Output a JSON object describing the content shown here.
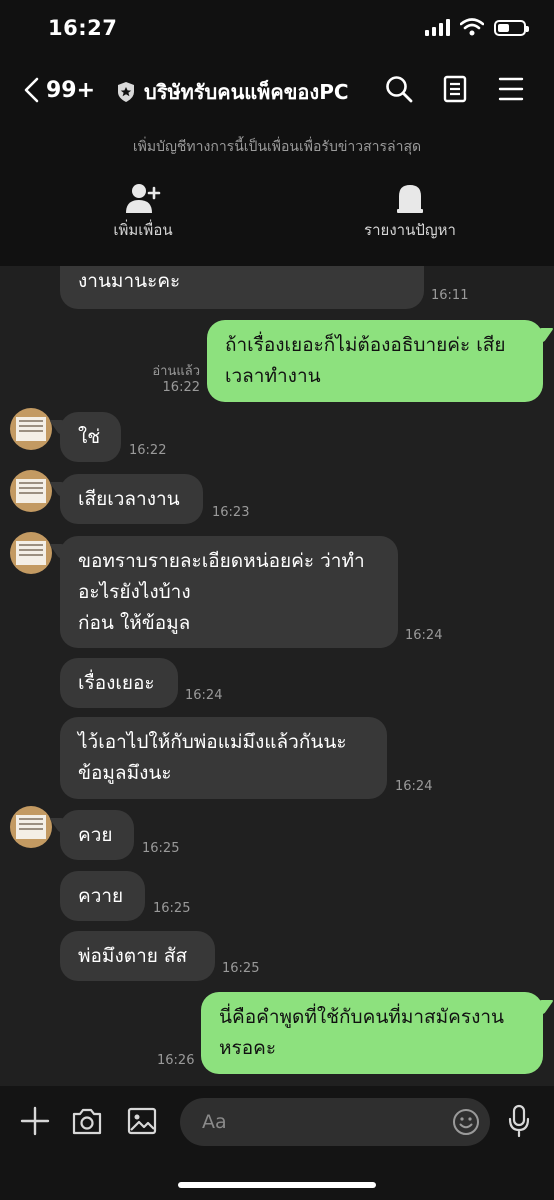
{
  "status_bar": {
    "time": "16:27",
    "battery_level": 0.45
  },
  "header": {
    "back_count": "99+",
    "title": "บริษัทรับคนแพ็คของPC",
    "subtitle": "เพิ่มบัญชีทางการนี้เป็นเพื่อนเพื่อรับข่าวสารล่าสุด",
    "actions": [
      {
        "label": "เพิ่มเพื่อน",
        "icon": "add-friend-icon"
      },
      {
        "label": "รายงานปัญหา",
        "icon": "report-icon"
      }
    ]
  },
  "messages": [
    {
      "sender": "them",
      "lines": [
        "งานมานะคะ"
      ],
      "time": "16:11"
    },
    {
      "sender": "me",
      "lines": [
        "ถ้าเรื่องเยอะก็ไม่ต้องอธิบายค่ะ เสีย",
        "เวลาทำงาน"
      ],
      "time": "16:22",
      "read_label": "อ่านแล้ว"
    },
    {
      "sender": "them",
      "lines": [
        "ใช่"
      ],
      "time": "16:22"
    },
    {
      "sender": "them",
      "lines": [
        "เสียเวลางาน"
      ],
      "time": "16:23"
    },
    {
      "sender": "them",
      "lines": [
        "ขอทราบรายละเอียดหน่อยค่ะ ว่าทำ",
        "อะไรยังไงบ้าง",
        "ก่อน ให้ข้อมูล"
      ],
      "time": "16:24"
    },
    {
      "sender": "them",
      "lines": [
        "เรื่องเยอะ"
      ],
      "time": "16:24"
    },
    {
      "sender": "them",
      "lines": [
        "ไว้เอาไปให้กับพ่อแม่มึงแล้วกันนะ",
        "ข้อมูลมึงนะ"
      ],
      "time": "16:24"
    },
    {
      "sender": "them",
      "lines": [
        "ควย"
      ],
      "time": "16:25"
    },
    {
      "sender": "them",
      "lines": [
        "ควาย"
      ],
      "time": "16:25"
    },
    {
      "sender": "them",
      "lines": [
        "พ่อมึงตาย สัส"
      ],
      "time": "16:25"
    },
    {
      "sender": "me",
      "lines": [
        "นี่คือคำพูดที่ใช้กับคนที่มาสมัครงาน",
        "หรอคะ"
      ],
      "time": "16:26"
    }
  ],
  "input": {
    "placeholder": "Aa"
  },
  "colors": {
    "outgoing_bubble": "#8de17e",
    "incoming_bubble": "#383838",
    "background": "#202020",
    "header": "#111111"
  }
}
